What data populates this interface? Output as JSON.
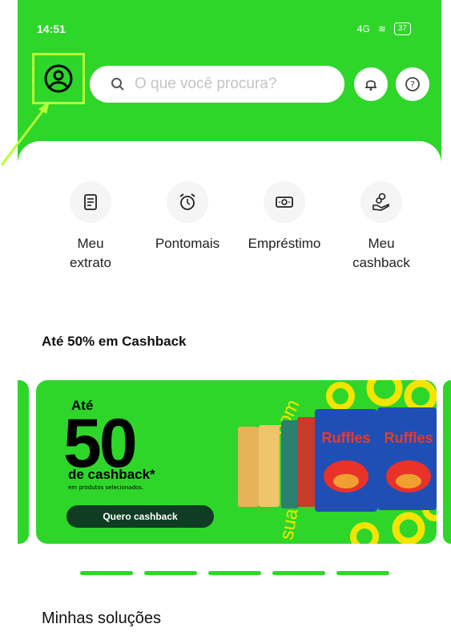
{
  "status_bar": {
    "time": "14:51",
    "extra": "▸ ···",
    "signal": "4G",
    "battery": "37"
  },
  "search": {
    "placeholder": "O que você procura?"
  },
  "quick_actions": [
    {
      "label": "Meu extrato",
      "icon": "statement-icon"
    },
    {
      "label": "Pontomais",
      "icon": "alarm-clock-icon"
    },
    {
      "label": "Empréstimo",
      "icon": "money-icon"
    },
    {
      "label": "Meu cashback",
      "icon": "hand-coin-icon"
    }
  ],
  "section": {
    "title": "Até 50% em Cashback"
  },
  "banner": {
    "ate": "Até",
    "big": "50",
    "sub": "de cashback*",
    "small": "em produtos selecionados.",
    "button": "Quero cashback",
    "brand": "Ruffles"
  },
  "solutions": {
    "title": "Minhas soluções"
  },
  "colors": {
    "brand_green": "#2ed62a",
    "highlight": "#b7ff3a",
    "dark_green": "#0f3d24"
  }
}
